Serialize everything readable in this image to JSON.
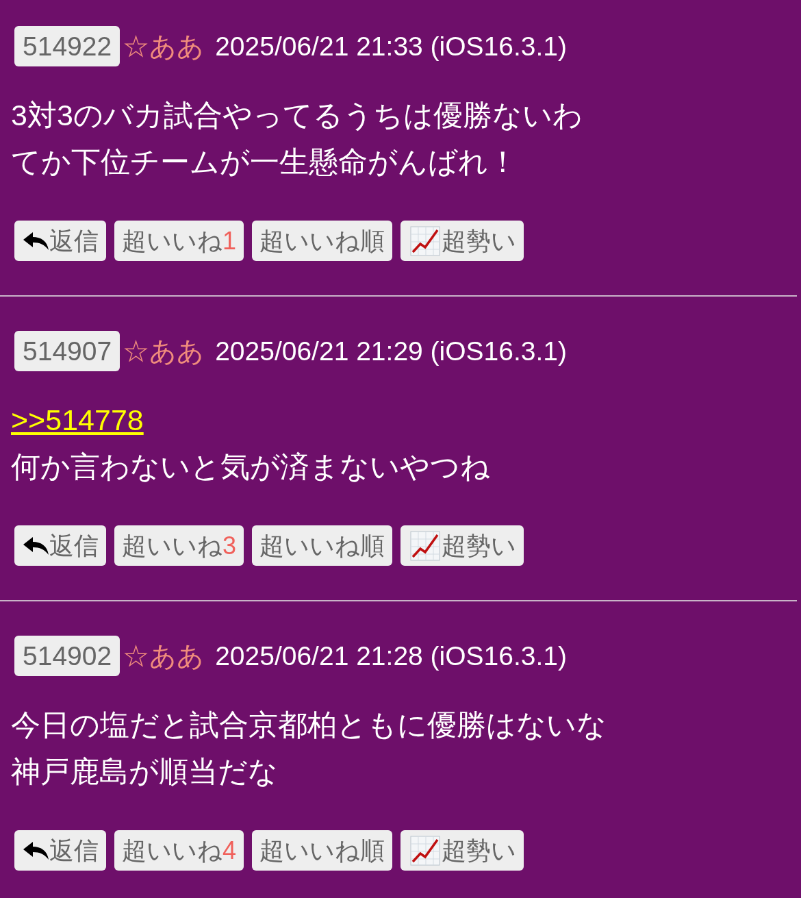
{
  "posts": [
    {
      "number": "514922",
      "name": "☆ああ",
      "date": "2025/06/21 21:33 (iOS16.3.1)",
      "lines": [
        {
          "kind": "text",
          "text": "3対3のバカ試合やってるうちは優勝ないわ"
        },
        {
          "kind": "text",
          "text": "てか下位チームが一生懸命がんばれ！"
        }
      ],
      "buttons": [
        {
          "kind": "reply",
          "label": "返信"
        },
        {
          "kind": "like",
          "label": "超いいね",
          "count": "1"
        },
        {
          "kind": "sort",
          "label": "超いいね順"
        },
        {
          "kind": "trend",
          "label": "超勢い"
        }
      ]
    },
    {
      "number": "514907",
      "name": "☆ああ",
      "date": "2025/06/21 21:29 (iOS16.3.1)",
      "lines": [
        {
          "kind": "anchor",
          "text": ">>514778"
        },
        {
          "kind": "text",
          "text": "何か言わないと気が済まないやつね"
        }
      ],
      "buttons": [
        {
          "kind": "reply",
          "label": "返信"
        },
        {
          "kind": "like",
          "label": "超いいね",
          "count": "3"
        },
        {
          "kind": "sort",
          "label": "超いいね順"
        },
        {
          "kind": "trend",
          "label": "超勢い"
        }
      ]
    },
    {
      "number": "514902",
      "name": "☆ああ",
      "date": "2025/06/21 21:28 (iOS16.3.1)",
      "lines": [
        {
          "kind": "text",
          "text": "今日の塩だと試合京都柏ともに優勝はないな"
        },
        {
          "kind": "text",
          "text": "神戸鹿島が順当だな"
        }
      ],
      "buttons": [
        {
          "kind": "reply",
          "label": "返信"
        },
        {
          "kind": "like",
          "label": "超いいね",
          "count": "4"
        },
        {
          "kind": "sort",
          "label": "超いいね順"
        },
        {
          "kind": "trend",
          "label": "超勢い"
        }
      ]
    }
  ]
}
